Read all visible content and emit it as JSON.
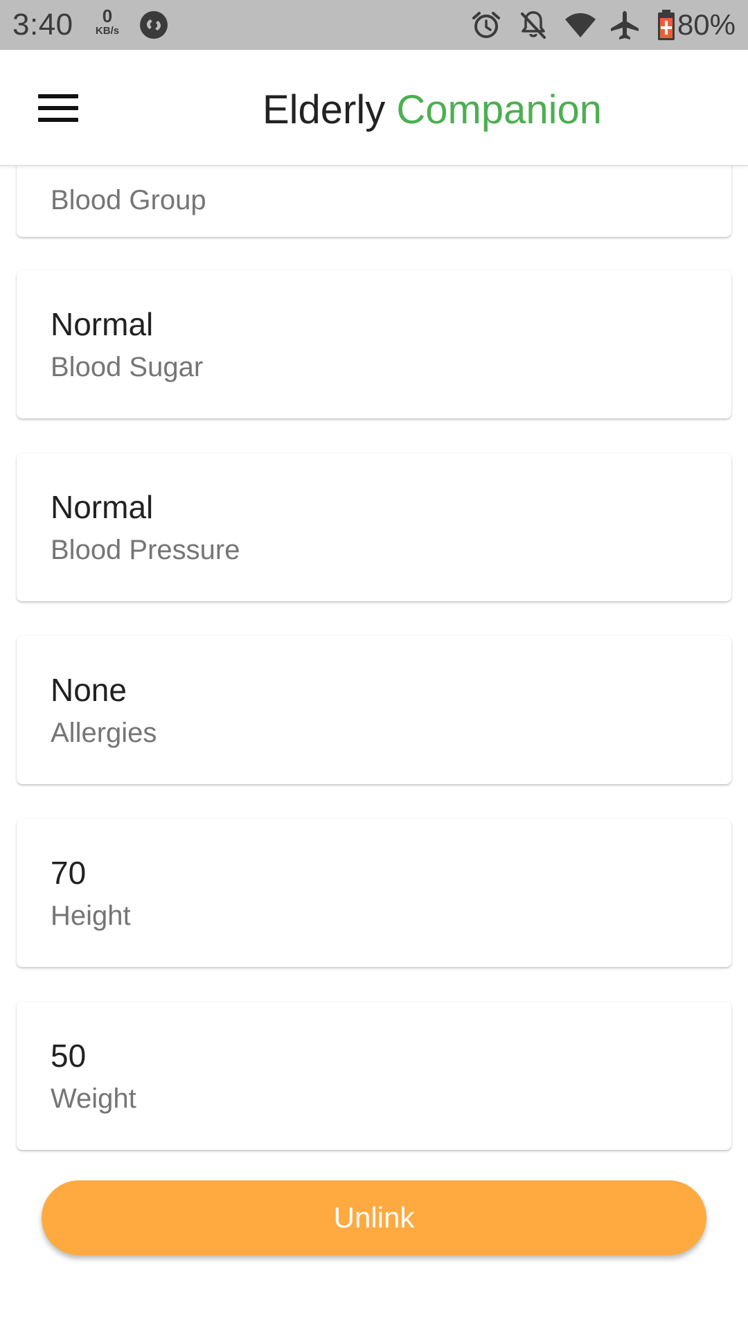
{
  "status_bar": {
    "time": "3:40",
    "net_speed_value": "0",
    "net_speed_unit": "KB/s",
    "battery_percent": "80%",
    "icons": [
      "shazam-icon",
      "alarm-icon",
      "notifications-off-icon",
      "wifi-icon",
      "airplane-mode-icon",
      "battery-charging-icon"
    ],
    "battery_color": "#e8603c"
  },
  "app_bar": {
    "title_part1": "Elderly",
    "title_part2": "Companion",
    "menu_icon": "hamburger-menu-icon",
    "accent_color": "#4caf50"
  },
  "cards": [
    {
      "value": "",
      "label": "Blood Group"
    },
    {
      "value": "Normal",
      "label": "Blood Sugar"
    },
    {
      "value": "Normal",
      "label": "Blood Pressure"
    },
    {
      "value": "None",
      "label": "Allergies"
    },
    {
      "value": "70",
      "label": "Height"
    },
    {
      "value": "50",
      "label": "Weight"
    }
  ],
  "unlink_button": {
    "label": "Unlink",
    "color": "#ffaa40"
  }
}
